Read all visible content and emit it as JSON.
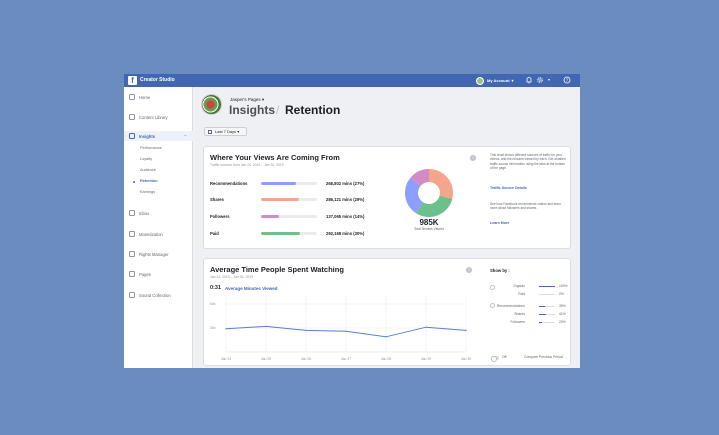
{
  "app": {
    "title": "Creator Studio",
    "logo": "f"
  },
  "topbar": {
    "account_label": "My Account",
    "icons": [
      "bell-icon",
      "gear-icon",
      "help-icon"
    ]
  },
  "sidebar": {
    "items": [
      {
        "label": "Home",
        "icon": "home-icon"
      },
      {
        "label": "Content Library",
        "icon": "library-icon"
      },
      {
        "label": "Insights",
        "icon": "chart-icon"
      },
      {
        "label": "Inbox",
        "icon": "inbox-icon"
      },
      {
        "label": "Monetization",
        "icon": "money-icon"
      },
      {
        "label": "Rights Manager",
        "icon": "rights-icon"
      },
      {
        "label": "Pages",
        "icon": "flag-icon"
      },
      {
        "label": "Sound Collection",
        "icon": "music-icon"
      }
    ],
    "insights_sub": [
      "Performance",
      "Loyalty",
      "Audience",
      "Retention",
      "Earnings"
    ]
  },
  "header": {
    "page_name": "Jasper's Pages ▾",
    "section": "Insights",
    "separator": "/",
    "title": "Retention"
  },
  "date_filter": {
    "label": "Last 7 Days ▾"
  },
  "views_card": {
    "title": "Where Your Views Are Coming From",
    "subtitle": "Traffic sources from Jan 24, 2019 – Jan 30, 2019",
    "rows": [
      {
        "label": "Recommendations",
        "value": "268,802 mins (27%)",
        "pct": 27,
        "color": "#8c9eff"
      },
      {
        "label": "Shares",
        "value": "286,121 mins (29%)",
        "pct": 29,
        "color": "#f4a58a"
      },
      {
        "label": "Followers",
        "value": "137,065 mins (14%)",
        "pct": 14,
        "color": "#d48ac9"
      },
      {
        "label": "Paid",
        "value": "292,168 mins (30%)",
        "pct": 30,
        "color": "#6cc08b"
      }
    ],
    "total_value": "985K",
    "total_caption": "Total Minutes Viewed",
    "side_text_1": "This chart shows different sources of traffic for your videos, and the minutes viewed by each. Get detailed traffic source information using the tabs at the bottom of the page.",
    "side_link_1": "Traffic Source Details",
    "side_text_2": "See how Facebook recommends videos and learn more about followers and shares.",
    "side_link_2": "Learn More"
  },
  "avg_card": {
    "title": "Average Time People Spent Watching",
    "subtitle": "Jan 24, 2019 – Jan 30, 2019",
    "avg_time": "0:31",
    "avg_label": "Average Minutes Viewed",
    "show_by_label": "Show by :",
    "groups": [
      [
        {
          "name": "Organic",
          "value": "100%",
          "pct": 100
        },
        {
          "name": "Paid",
          "value": "0%",
          "pct": 0
        }
      ],
      [
        {
          "name": "Recommendations",
          "value": "39%",
          "pct": 39
        },
        {
          "name": "Shares",
          "value": "41%",
          "pct": 41
        },
        {
          "name": "Followers",
          "value": "20%",
          "pct": 20
        }
      ]
    ],
    "toggle_label": "Off",
    "compare_label": "Compare Previous Period"
  },
  "colors": {
    "accent": "#4267b2",
    "background": "#6b8cbf"
  },
  "chart_data": {
    "type": "line",
    "x": [
      "Jan 24",
      "Jan 25",
      "Jan 26",
      "Jan 27",
      "Jan 28",
      "Jan 29",
      "Jan 30"
    ],
    "y_ticks": [
      "60s",
      "30s"
    ],
    "series": [
      {
        "values": [
          29,
          32,
          27,
          26,
          19,
          31,
          27
        ]
      }
    ],
    "ylim": [
      0,
      70
    ],
    "grid": true
  }
}
